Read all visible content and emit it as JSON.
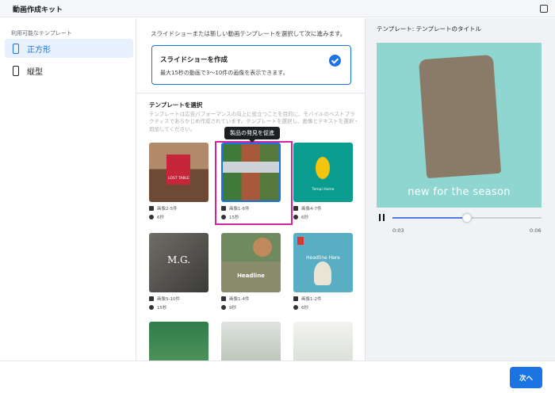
{
  "window": {
    "title": "動画作成キット"
  },
  "sidebar": {
    "section_label": "利用可能なテンプレート",
    "items": [
      {
        "label": "正方形",
        "icon": "square-device-icon",
        "active": true
      },
      {
        "label": "縦型",
        "icon": "vertical-device-icon",
        "active": false
      }
    ]
  },
  "main": {
    "instruction": "スライドショーまたは新しい動画テンプレートを選択して次に進みます。",
    "slideshow_card": {
      "title": "スライドショーを作成",
      "description": "最大15秒の動画で3〜10件の画像を表示できます。",
      "selected": true
    },
    "templates_title": "テンプレートを選択",
    "templates_description": "テンプレートは広告パフォーマンスの向上に役立つことを目的に、モバイルのベストプラクティスであらかじめ作成されています。テンプレートを選択し、画像とテキストを選択・追加してください。",
    "tooltip": "製品の発見を促進",
    "templates": [
      {
        "images": "画像2-5件",
        "duration": "6秒",
        "thumb_text": "LOST TABLE",
        "highlighted": false
      },
      {
        "images": "画像1-6件",
        "duration": "15秒",
        "thumb_text": "",
        "highlighted": true
      },
      {
        "images": "画像4-7件",
        "duration": "6秒",
        "thumb_text": "Tempi Home",
        "highlighted": false
      },
      {
        "images": "画像5-10件",
        "duration": "15秒",
        "thumb_text": "M.G.",
        "highlighted": false
      },
      {
        "images": "画像1-4件",
        "duration": "9秒",
        "thumb_text": "Headline",
        "highlighted": false
      },
      {
        "images": "画像1-2件",
        "duration": "6秒",
        "thumb_text": "Headline Here",
        "highlighted": false
      }
    ]
  },
  "preview": {
    "title": "テンプレート: テンプレートのタイトル",
    "overlay_text": "new for the season",
    "current_time": "0:03",
    "total_time": "0:06",
    "progress": 0.5
  },
  "footer": {
    "next_label": "次へ"
  },
  "colors": {
    "accent": "#1b74e4",
    "highlight": "#d6239c",
    "preview_bg": "#8fd6d0"
  }
}
